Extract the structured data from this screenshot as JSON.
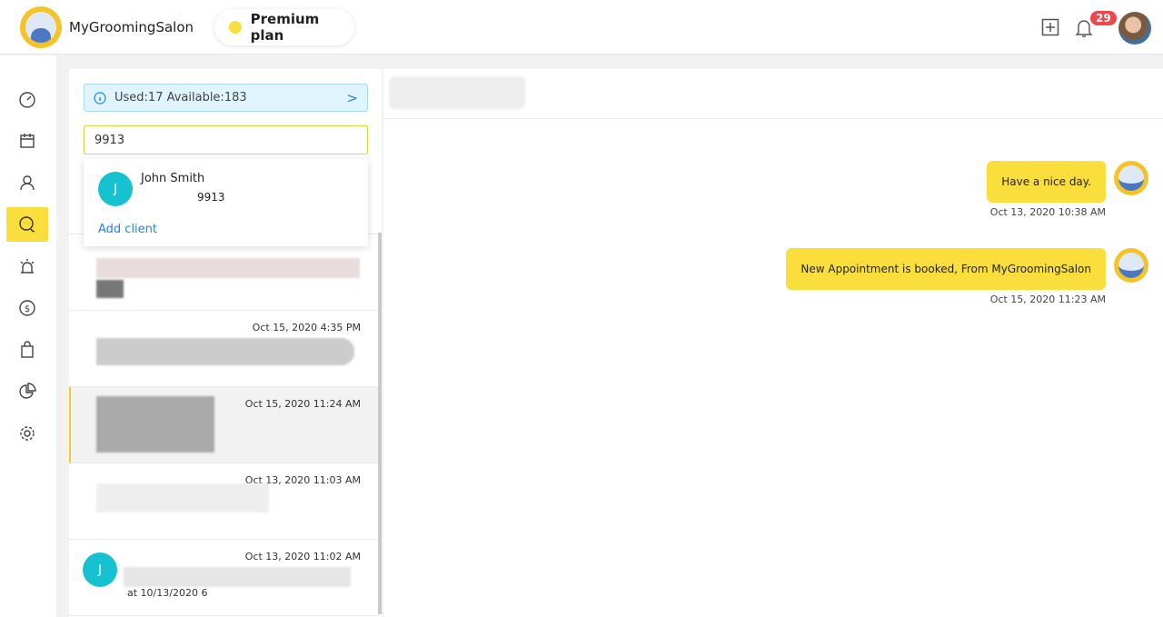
{
  "header": {
    "brand": "MyGroomingSalon",
    "plan": "Premium plan",
    "notification_count": "29"
  },
  "sidebar": {
    "items": [
      {
        "icon": "dashboard-icon"
      },
      {
        "icon": "calendar-icon"
      },
      {
        "icon": "user-icon"
      },
      {
        "icon": "chat-icon",
        "active": true
      },
      {
        "icon": "alarm-icon"
      },
      {
        "icon": "dollar-icon"
      },
      {
        "icon": "shopping-bag-icon"
      },
      {
        "icon": "pie-chart-icon"
      },
      {
        "icon": "settings-icon"
      }
    ]
  },
  "list": {
    "quota": "Used:17 Available:183",
    "search_value": "9913",
    "dropdown": {
      "result": {
        "initial": "J",
        "name": "John Smith",
        "phone": "9913"
      },
      "add_client": "Add client"
    },
    "conversations": [
      {
        "time": "Oct 15, 2020 4:35 PM"
      },
      {
        "time": "Oct 15, 2020 11:24 AM",
        "selected": true
      },
      {
        "time": "Oct 13, 2020 11:03 AM"
      },
      {
        "time": "Oct 13, 2020 11:02 AM",
        "initial": "J",
        "preview": "at 10/13/2020 6"
      }
    ]
  },
  "chat": {
    "messages": [
      {
        "text": "Have a nice day.",
        "time": "Oct 13, 2020 10:38 AM"
      },
      {
        "text": "New Appointment is booked, From MyGroomingSalon",
        "time": "Oct 15, 2020 11:23 AM"
      }
    ]
  },
  "colors": {
    "accent": "#fadf3c",
    "teal": "#16c2cf",
    "badge": "#f0454d",
    "link": "#1c86e6"
  }
}
